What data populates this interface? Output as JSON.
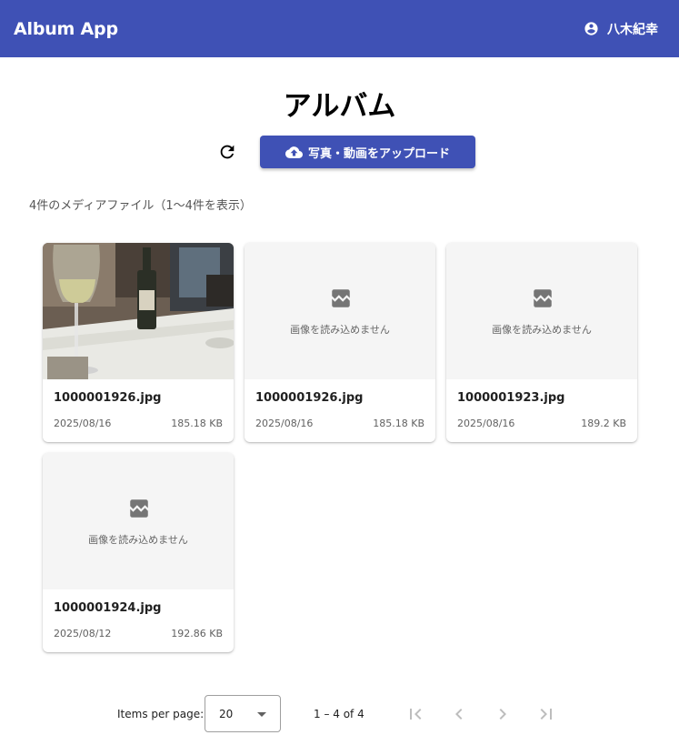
{
  "header": {
    "app_title": "Album App",
    "user_name": "八木紀幸",
    "user_icon": "account-circle-icon"
  },
  "page": {
    "title": "アルバム"
  },
  "actions": {
    "refresh_icon": "refresh-icon",
    "upload_label": "写真・動画をアップロード",
    "upload_icon": "cloud-upload-icon"
  },
  "summary": "4件のメディアファイル（1〜4件を表示）",
  "media": [
    {
      "filename": "1000001926.jpg",
      "date": "2025/08/16",
      "size": "185.18 KB",
      "loaded": true
    },
    {
      "filename": "1000001926.jpg",
      "date": "2025/08/16",
      "size": "185.18 KB",
      "loaded": false,
      "error_text": "画像を読み込めません"
    },
    {
      "filename": "1000001923.jpg",
      "date": "2025/08/16",
      "size": "189.2 KB",
      "loaded": false,
      "error_text": "画像を読み込めません"
    },
    {
      "filename": "1000001924.jpg",
      "date": "2025/08/12",
      "size": "192.86 KB",
      "loaded": false,
      "error_text": "画像を読み込めません"
    }
  ],
  "paginator": {
    "items_per_page_label": "Items per page:",
    "page_size": "20",
    "range_label": "1 – 4 of 4",
    "first_icon": "first-page-icon",
    "prev_icon": "chevron-left-icon",
    "next_icon": "chevron-right-icon",
    "last_icon": "last-page-icon"
  },
  "colors": {
    "primary": "#3f51b5",
    "placeholder_bg": "#f5f5f5",
    "disabled": "#bdbdbd"
  }
}
